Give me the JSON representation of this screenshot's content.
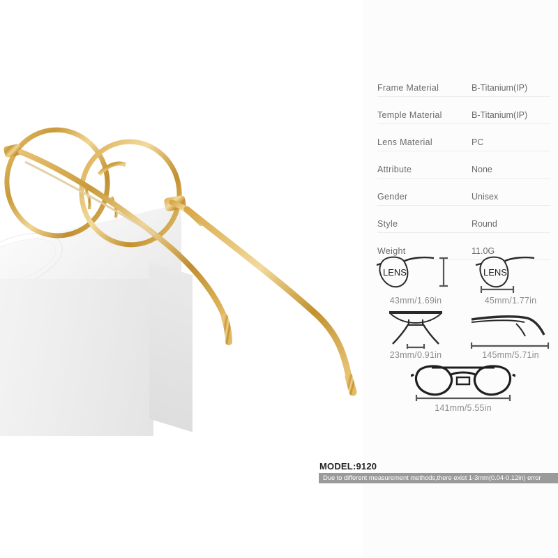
{
  "product": {
    "photo_alt": "gold round titanium eyeglasses resting on white box",
    "frame_color": "#D8A441",
    "box_color": "#F2F2F2"
  },
  "specs": {
    "rows": [
      {
        "label": "Frame  Material",
        "value": "B-Titanium(IP)"
      },
      {
        "label": "Temple  Material",
        "value": "B-Titanium(IP)"
      },
      {
        "label": "Lens  Material",
        "value": "PC"
      },
      {
        "label": "Attribute",
        "value": "None"
      },
      {
        "label": "Gender",
        "value": "Unisex"
      },
      {
        "label": "Style",
        "value": "Round"
      },
      {
        "label": "Weight",
        "value": "11.0G"
      }
    ]
  },
  "dimensions": {
    "lens_text": "LENS",
    "items": [
      {
        "name": "lens-height",
        "icon": "lens-height-icon",
        "text": "43mm/1.69in"
      },
      {
        "name": "lens-width",
        "icon": "lens-width-icon",
        "text": "45mm/1.77in"
      },
      {
        "name": "bridge-width",
        "icon": "bridge-icon",
        "text": "23mm/0.91in"
      },
      {
        "name": "temple-length",
        "icon": "temple-icon",
        "text": "145mm/5.71in"
      },
      {
        "name": "frame-width",
        "icon": "full-frame-icon",
        "text": "141mm/5.55in"
      }
    ]
  },
  "footer": {
    "model": "MODEL:9120",
    "disclaimer": "Due to different measurement methods,there exist 1-3mm(0.04-0.12in) error",
    "disclaimer_bg": "#9A9A9A"
  }
}
